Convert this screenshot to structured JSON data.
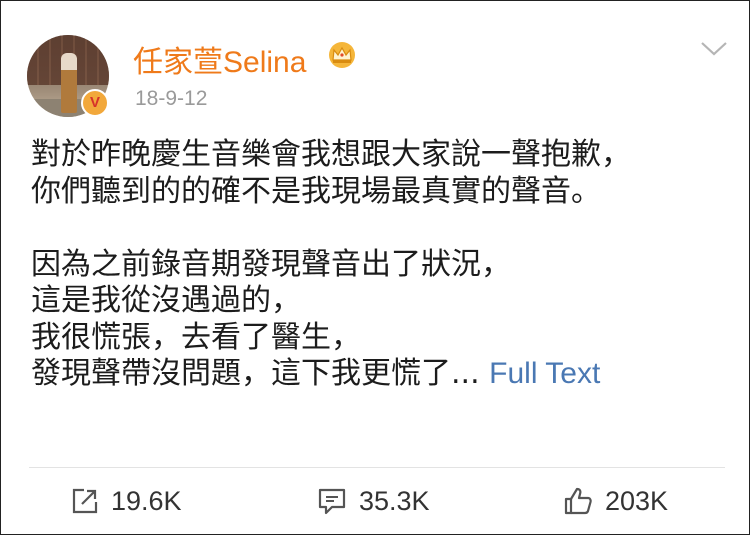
{
  "post": {
    "username": "任家萱Selina",
    "date": "18-9-12",
    "verified_badge": "V",
    "paragraph1": [
      "對於昨晚慶生音樂會我想跟大家說一聲抱歉，",
      "你們聽到的的確不是我現場最真實的聲音。"
    ],
    "paragraph2": [
      "因為之前錄音期發現聲音出了狀況，",
      "這是我從沒遇過的，",
      "我很慌張，去看了醫生，",
      "發現聲帶沒問題，這下我更慌了..."
    ],
    "full_text_link": "Full Text"
  },
  "actions": {
    "share_count": "19.6K",
    "comment_count": "35.3K",
    "like_count": "203K"
  },
  "colors": {
    "username": "#ef7a1a",
    "link": "#4a78b3",
    "badge": "#f2a83b",
    "date": "#9a9a9a"
  },
  "icons": [
    "crown-icon",
    "chevron-down-icon",
    "share-icon",
    "comment-icon",
    "like-icon",
    "verified-badge-icon"
  ]
}
